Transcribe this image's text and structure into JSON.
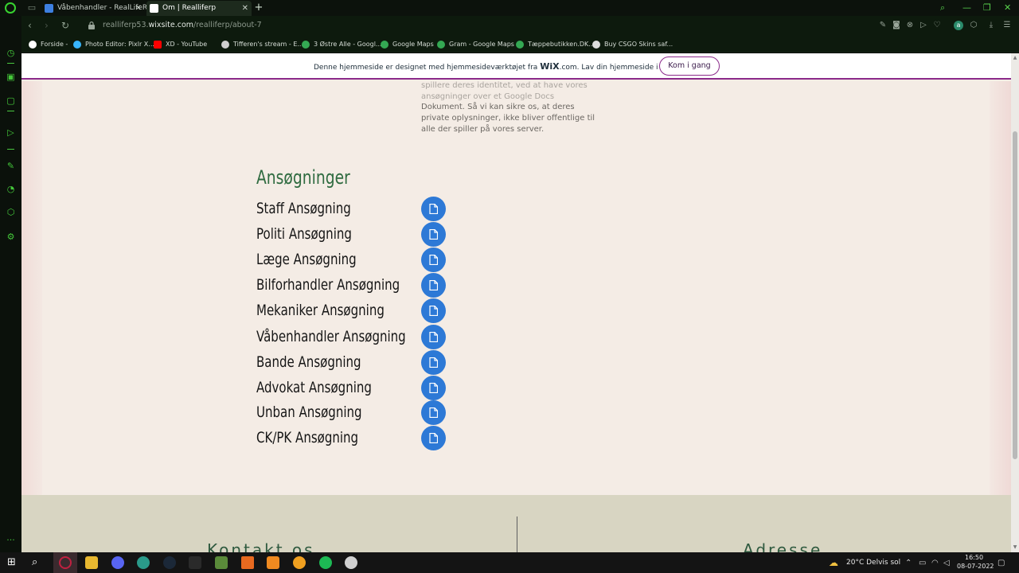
{
  "browser": {
    "tabs": [
      {
        "title": "Våbenhandler - RealLifeRP",
        "active": false
      },
      {
        "title": "Om | Realliferp",
        "active": true
      }
    ],
    "new_tab": "+",
    "url_prefix": "realliferp53.",
    "url_domain": "wixsite.com",
    "url_path": "/realliferp/about-7",
    "bookmarks": [
      {
        "label": "Forside -",
        "color": "#ffffff"
      },
      {
        "label": "Photo Editor: Pixlr X...",
        "color": "#38b6ff"
      },
      {
        "label": "XD - YouTube",
        "color": "#ff0000"
      },
      {
        "label": "Tifferen's stream - E...",
        "color": "#cfcfcf"
      },
      {
        "label": "3 Østre Alle - Googl...",
        "color": "#34a853"
      },
      {
        "label": "Google Maps",
        "color": "#34a853"
      },
      {
        "label": "Gram - Google Maps",
        "color": "#34a853"
      },
      {
        "label": "Tæppebutikken.DK...",
        "color": "#34a853"
      },
      {
        "label": "Buy CSGO Skins saf...",
        "color": "#dddddd"
      }
    ]
  },
  "wix_banner": {
    "text_before": "Denne hjemmeside er designet med hjemmesideværktøjet fra ",
    "wix_word": "WiX",
    "text_after": ".com. Lav din hjemmeside i dag.",
    "button": "Kom i gang"
  },
  "intro_lines": [
    "spillere deres identitet, ved at have vores",
    "ansøgninger over et Google Docs",
    "Dokument. Så vi kan sikre os, at deres",
    "private oplysninger, ikke bliver offentlige til",
    "alle der spiller på vores server."
  ],
  "applications": {
    "heading": "Ansøgninger",
    "items": [
      "Staff Ansøgning",
      "Politi Ansøgning",
      "Læge Ansøgning",
      "Bilforhandler Ansøgning",
      "Mekaniker Ansøgning",
      "Våbenhandler Ansøgning",
      "Bande Ansøgning",
      "Advokat Ansøgning",
      "Unban Ansøgning",
      "CK/PK Ansøgning"
    ]
  },
  "footer": {
    "contact_title": "Kontakt os",
    "address_title": "Adresse"
  },
  "taskbar": {
    "weather": "20°C  Delvis sol",
    "time": "16:50",
    "date": "08-07-2022"
  },
  "colors": {
    "accent_green": "#2f6b40",
    "doc_button_blue": "#2d79d6",
    "wix_purple": "#8b2a8a",
    "page_bg": "#f4ece5",
    "footer_bg": "#d8d5c2"
  }
}
